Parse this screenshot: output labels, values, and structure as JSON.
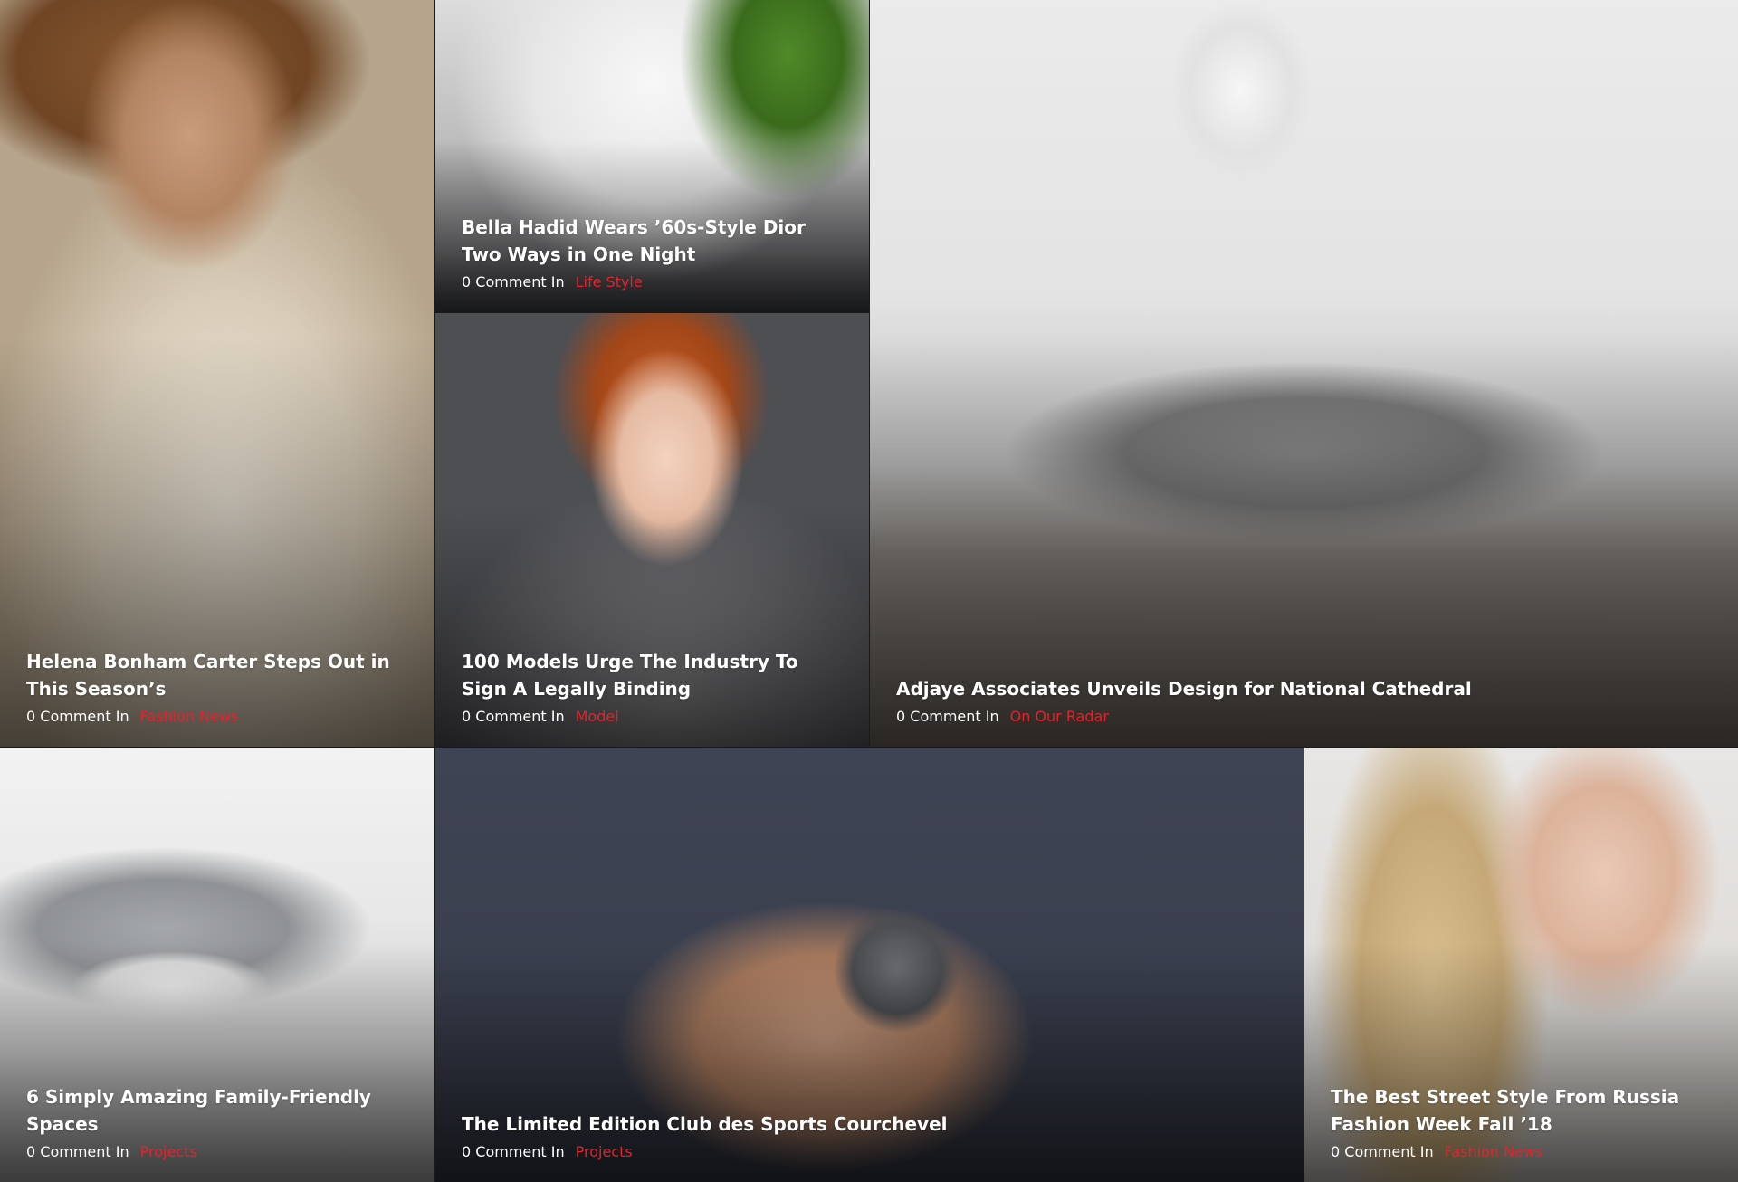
{
  "posts": [
    {
      "title": "Helena Bonham Carter Steps Out in This Season’s",
      "comments": "0 Comment In",
      "category": "Fashion News"
    },
    {
      "title": "Bella Hadid Wears ’60s-Style Dior Two Ways in One Night",
      "comments": "0 Comment In",
      "category": "Life Style"
    },
    {
      "title": "100 Models Urge The Industry To Sign A Legally Binding",
      "comments": "0 Comment In",
      "category": "Model"
    },
    {
      "title": "Adjaye Associates Unveils Design for National Cathedral",
      "comments": "0 Comment In",
      "category": "On Our Radar"
    },
    {
      "title": "6 Simply Amazing Family-Friendly Spaces",
      "comments": "0 Comment In",
      "category": "Projects"
    },
    {
      "title": "The Limited Edition Club des Sports Courchevel",
      "comments": "0 Comment In",
      "category": "Projects"
    },
    {
      "title": "The Best Street Style From Russia Fashion Week Fall ’18",
      "comments": "0 Comment In",
      "category": "Fashion News"
    }
  ],
  "colors": {
    "category": "#e3232d",
    "text": "#ffffff"
  }
}
